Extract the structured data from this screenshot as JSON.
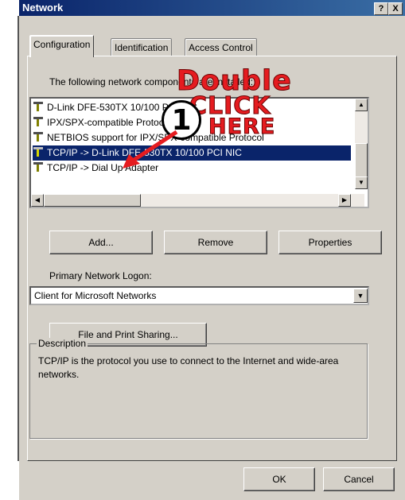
{
  "window": {
    "title": "Network",
    "help_button": "?",
    "close_button": "X"
  },
  "tabs": [
    {
      "label": "Configuration",
      "active": true
    },
    {
      "label": "Identification",
      "active": false
    },
    {
      "label": "Access Control",
      "active": false
    }
  ],
  "components": {
    "label": "The following network components are installed:",
    "items": [
      {
        "label": "D-Link DFE-530TX 10/100 PCI NIC",
        "icon": "network-icon",
        "selected": false
      },
      {
        "label": "IPX/SPX-compatible Protocol",
        "icon": "protocol-icon",
        "selected": false
      },
      {
        "label": "NETBIOS support for IPX/SPX-compatible Protocol",
        "icon": "protocol-icon",
        "selected": false
      },
      {
        "label": "TCP/IP -> D-Link DFE-530TX 10/100 PCI NIC",
        "icon": "protocol-icon",
        "selected": true
      },
      {
        "label": "TCP/IP -> Dial Up Adapter",
        "icon": "protocol-icon",
        "selected": false
      }
    ]
  },
  "buttons": {
    "add": "Add...",
    "remove": "Remove",
    "properties": "Properties",
    "file_print": "File and Print Sharing...",
    "ok": "OK",
    "cancel": "Cancel"
  },
  "logon": {
    "label": "Primary Network Logon:",
    "value": "Client for Microsoft Networks"
  },
  "description": {
    "legend": "Description",
    "text": "TCP/IP is the protocol you use to connect to the Internet and wide-area networks."
  },
  "annotation": {
    "line1": "Double",
    "line2": "CLICK",
    "line3": "HERE",
    "badge": "1",
    "color": "#e51c20"
  },
  "colors": {
    "title_bar": "#0a246a",
    "selection": "#0a246a",
    "face": "#d4d0c8"
  }
}
